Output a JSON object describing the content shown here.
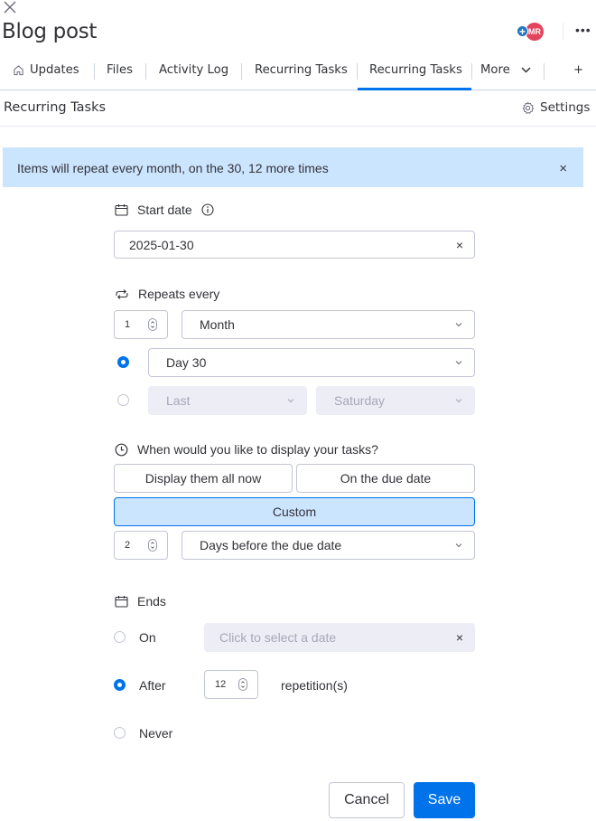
{
  "header": {
    "title": "Blog post",
    "avatar_initials": "MR",
    "avatar_plus": "+",
    "more_menu": "•••",
    "close_icon": "close-icon"
  },
  "tabs": {
    "items": [
      {
        "label": "Updates",
        "icon": "home-icon"
      },
      {
        "label": "Files"
      },
      {
        "label": "Activity Log"
      },
      {
        "label": "Recurring Tasks"
      },
      {
        "label": "Recurring Tasks",
        "active": true
      }
    ],
    "more_label": "More",
    "add_label": "+"
  },
  "section": {
    "title": "Recurring Tasks",
    "settings_label": "Settings"
  },
  "banner": {
    "text": "Items will repeat every month, on the 30, 12 more times",
    "close": "×"
  },
  "start_date": {
    "label": "Start date",
    "value": "2025-01-30",
    "clear": "×"
  },
  "repeats": {
    "label": "Repeats every",
    "interval": "1",
    "unit": "Month",
    "option_day": {
      "value": "Day 30",
      "selected": true
    },
    "option_weekday": {
      "ordinal": "Last",
      "weekday": "Saturday",
      "selected": false
    }
  },
  "display": {
    "label": "When would you like to display your tasks?",
    "options": [
      "Display them all now",
      "On the due date",
      "Custom"
    ],
    "selected": "Custom",
    "custom_days": "2",
    "custom_unit": "Days before the due date"
  },
  "ends": {
    "label": "Ends",
    "on_label": "On",
    "on_placeholder": "Click to select a date",
    "after_label": "After",
    "after_value": "12",
    "after_suffix": "repetition(s)",
    "never_label": "Never",
    "selected": "After",
    "clear": "×"
  },
  "footer": {
    "cancel_label": "Cancel",
    "save_label": "Save"
  },
  "colors": {
    "primary": "#0073ea",
    "banner_bg": "#cce5ff",
    "avatar": "#e2445c"
  }
}
